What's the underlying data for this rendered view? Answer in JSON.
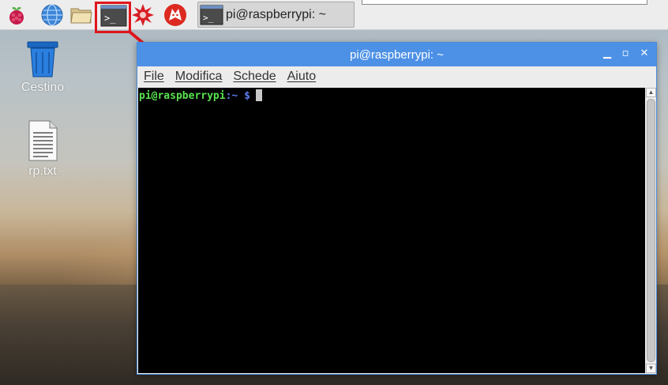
{
  "taskbar": {
    "launchers": [
      {
        "icon": "raspberry-menu-icon"
      },
      {
        "icon": "web-browser-globe-icon"
      },
      {
        "icon": "file-manager-folder-icon"
      },
      {
        "icon": "terminal-icon"
      },
      {
        "icon": "mathematica-icon"
      },
      {
        "icon": "wolfram-icon"
      }
    ],
    "task_button_label": "pi@raspberrypi: ~",
    "highlight_color": "#e0161d"
  },
  "desktop": {
    "icons": [
      {
        "label": "Cestino",
        "icon": "trash-icon"
      },
      {
        "label": "rp.txt",
        "icon": "text-file-icon"
      }
    ]
  },
  "window": {
    "title": "pi@raspberrypi: ~",
    "controls": [
      "minimize",
      "maximize",
      "close"
    ],
    "menu": [
      {
        "label": "File"
      },
      {
        "label": "Modifica"
      },
      {
        "label": "Schede"
      },
      {
        "label": "Aiuto"
      }
    ],
    "terminal": {
      "prompt_user": "pi@raspberrypi",
      "prompt_path": ":~",
      "prompt_symbol": "$"
    },
    "titlebar_color": "#4d91e6"
  }
}
